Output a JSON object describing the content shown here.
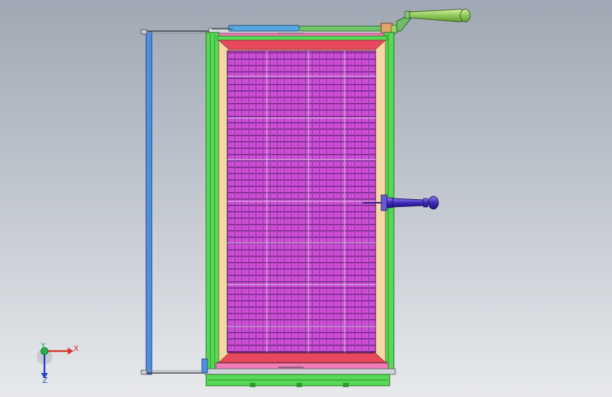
{
  "viewport": {
    "background_top": "#9fa8b4",
    "background_bottom": "#e7e9ec"
  },
  "model": {
    "frame_green": "#56d956",
    "inner_frame_orange": "#f2c98f",
    "mesh_magenta": "#d14fd6",
    "mesh_dark": "#7a2a90",
    "top_bar_blue": "#54a9e0",
    "left_rail_blue": "#4e8fe0",
    "pink_bar": "#f07cb8",
    "crank_handle_color": "#9fd36a",
    "door_handle_color": "#4a35c8",
    "icons": {
      "crank_handle": "crank-handle-icon",
      "door_handle": "door-handle-icon"
    }
  },
  "triad": {
    "x_label": "X",
    "y_label": "Y",
    "z_label": "Z",
    "x_color": "#d8332e",
    "y_color": "#22b14c",
    "z_color": "#2940c8"
  }
}
